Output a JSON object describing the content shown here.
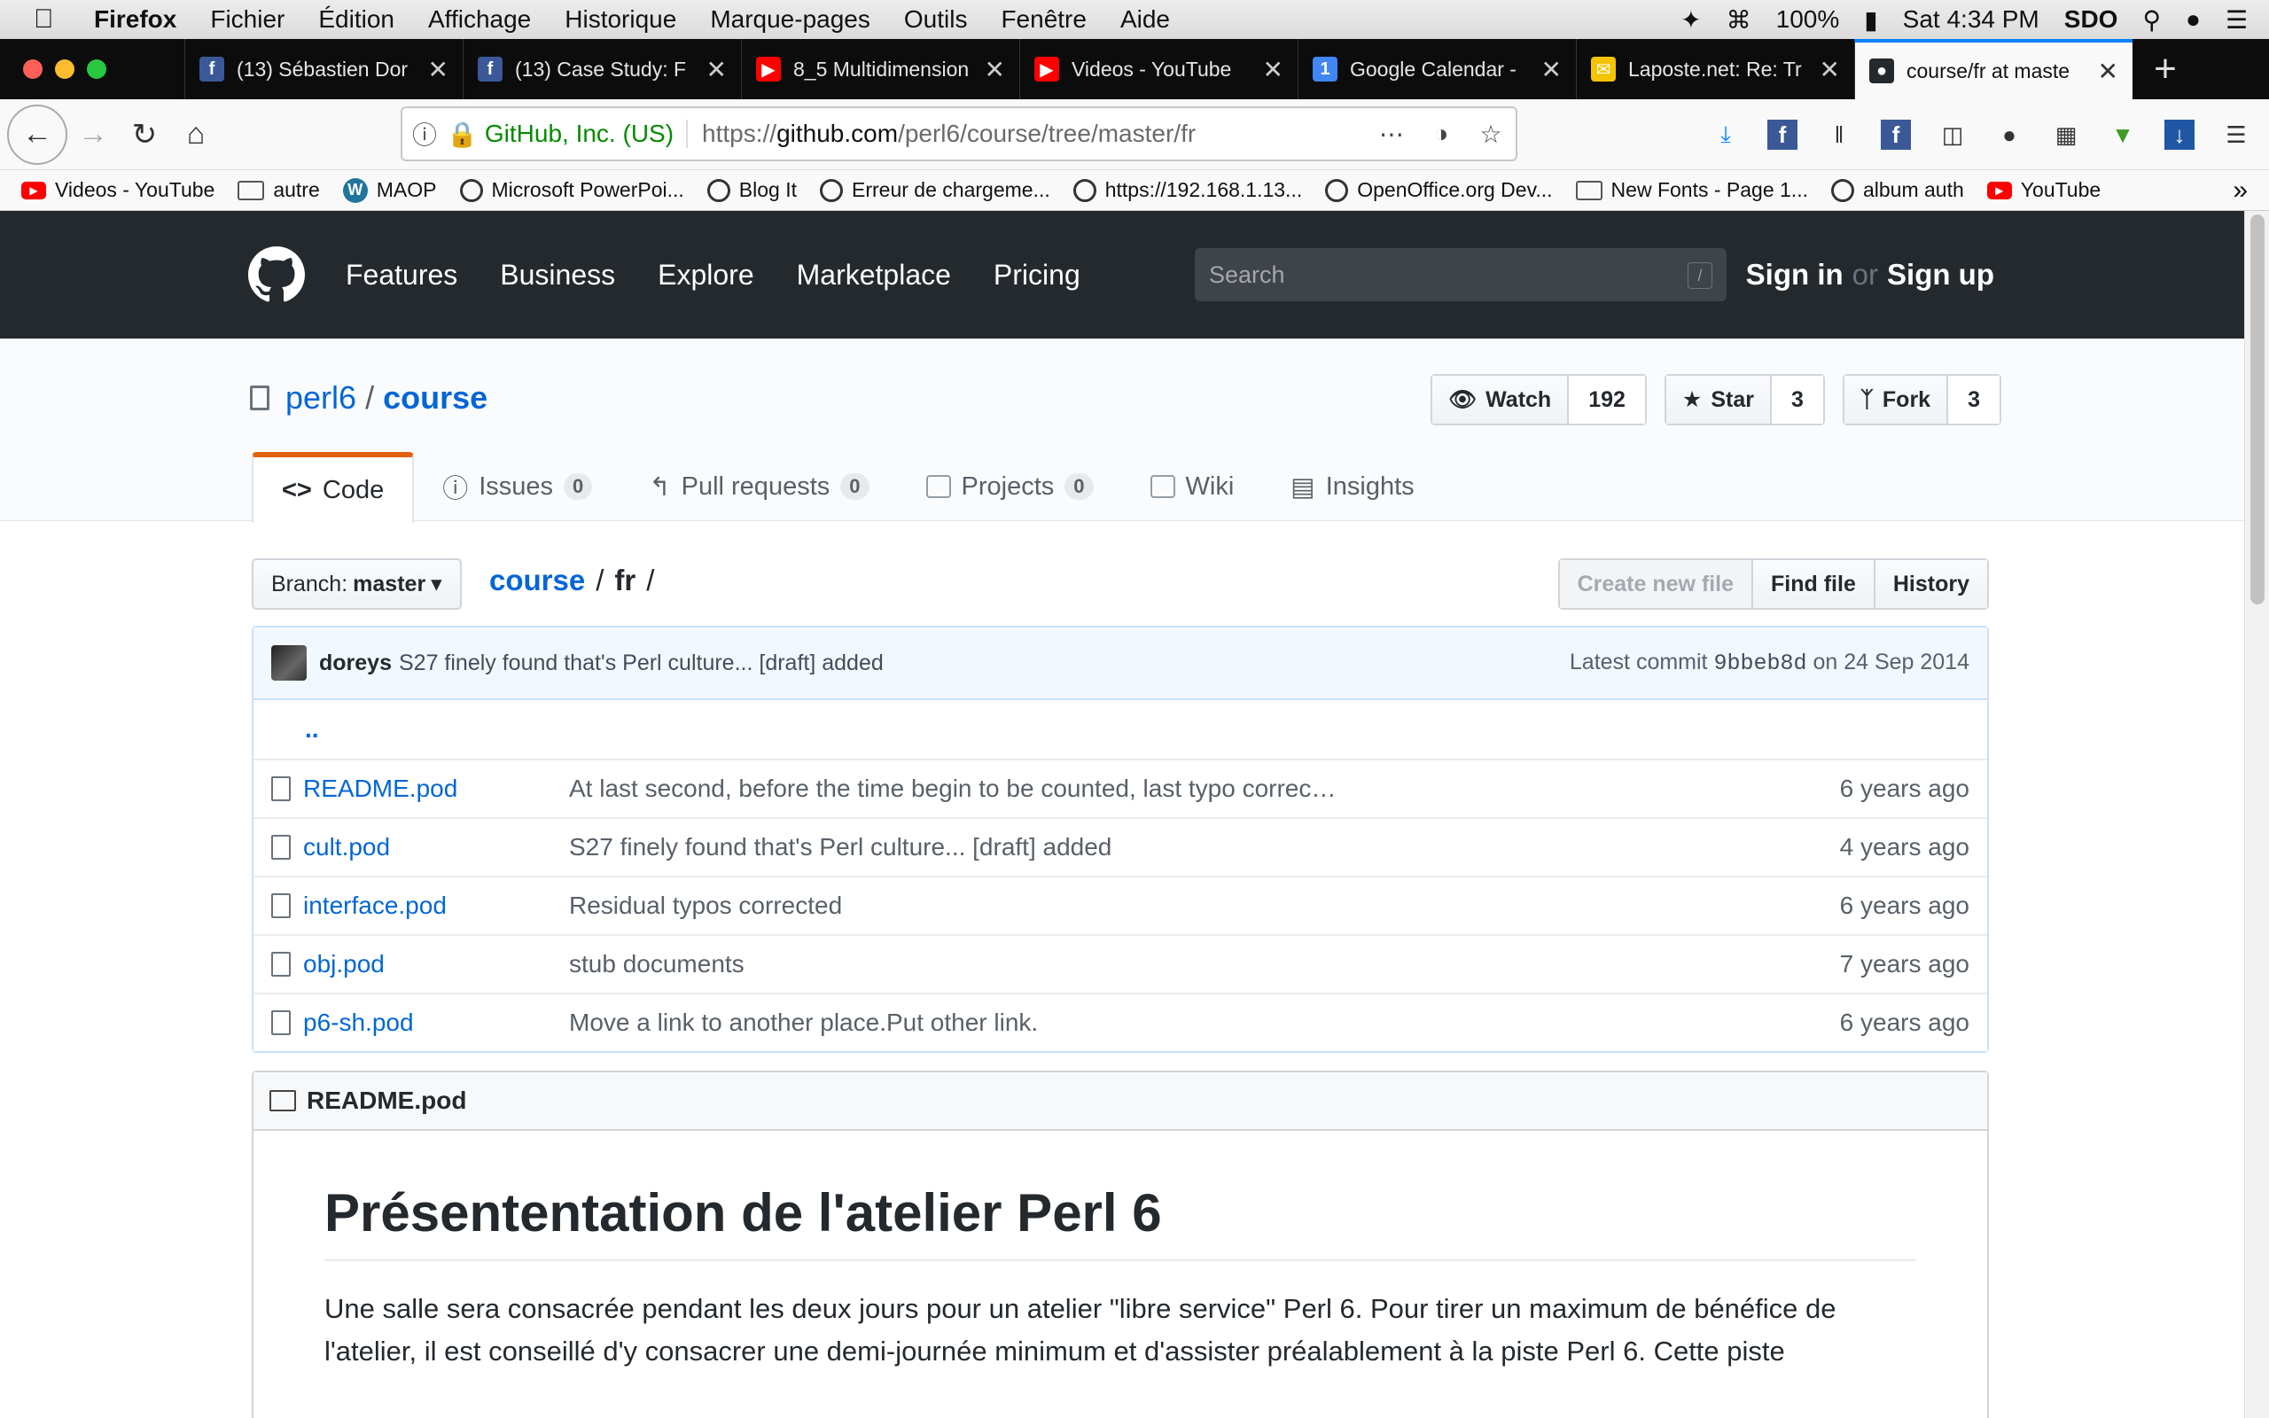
{
  "menubar": {
    "app": "Firefox",
    "items": [
      "Fichier",
      "Édition",
      "Affichage",
      "Historique",
      "Marque-pages",
      "Outils",
      "Fenêtre",
      "Aide"
    ],
    "battery": "100%",
    "clock": "Sat 4:34 PM",
    "user": "SDO"
  },
  "tabs": [
    {
      "title": "(13) Sébastien Dor",
      "icon": "facebook-icon",
      "color": "#3b5998",
      "glyph": "f"
    },
    {
      "title": "(13) Case Study: F",
      "icon": "facebook-icon",
      "color": "#3b5998",
      "glyph": "f"
    },
    {
      "title": "8_5 Multidimension",
      "icon": "youtube-icon",
      "color": "#ff0000",
      "glyph": "▶"
    },
    {
      "title": "Videos - YouTube",
      "icon": "youtube-icon",
      "color": "#ff0000",
      "glyph": "▶"
    },
    {
      "title": "Google Calendar -",
      "icon": "calendar-icon",
      "color": "#4285f4",
      "glyph": "1"
    },
    {
      "title": "Laposte.net: Re: Tr",
      "icon": "laposte-icon",
      "color": "#f4c400",
      "glyph": "✉"
    },
    {
      "title": "course/fr at maste",
      "icon": "github-icon",
      "color": "#24292e",
      "glyph": "●",
      "active": true
    }
  ],
  "urlbar": {
    "site": "GitHub, Inc. (US)",
    "url_prefix": "https://",
    "url_domain": "github.com",
    "url_path": "/perl6/course/tree/master/fr"
  },
  "bookmarks": [
    {
      "label": "Videos - YouTube",
      "icon": "youtube-icon"
    },
    {
      "label": "autre",
      "icon": "folder-icon"
    },
    {
      "label": "MAOP",
      "icon": "wordpress-icon"
    },
    {
      "label": "Microsoft PowerPoi...",
      "icon": "globe-icon"
    },
    {
      "label": "Blog It",
      "icon": "globe-icon"
    },
    {
      "label": "Erreur de chargeme...",
      "icon": "globe-icon"
    },
    {
      "label": "https://192.168.1.13...",
      "icon": "globe-icon"
    },
    {
      "label": "OpenOffice.org Dev...",
      "icon": "globe-icon"
    },
    {
      "label": "New Fonts - Page 1...",
      "icon": "fonts-icon"
    },
    {
      "label": "album auth",
      "icon": "globe-icon"
    },
    {
      "label": "YouTube",
      "icon": "youtube-icon"
    }
  ],
  "github": {
    "nav": [
      "Features",
      "Business",
      "Explore",
      "Marketplace",
      "Pricing"
    ],
    "search_placeholder": "Search",
    "search_key": "/",
    "sign_in": "Sign in",
    "or": "or",
    "sign_up": "Sign up"
  },
  "repo": {
    "owner": "perl6",
    "name": "course",
    "watch_label": "Watch",
    "watch_count": "192",
    "star_label": "Star",
    "star_count": "3",
    "fork_label": "Fork",
    "fork_count": "3",
    "tabs": [
      {
        "label": "Code",
        "counter": ""
      },
      {
        "label": "Issues",
        "counter": "0"
      },
      {
        "label": "Pull requests",
        "counter": "0"
      },
      {
        "label": "Projects",
        "counter": "0"
      },
      {
        "label": "Wiki",
        "counter": ""
      },
      {
        "label": "Insights",
        "counter": ""
      }
    ]
  },
  "filenav": {
    "branch_prefix": "Branch:",
    "branch": "master",
    "path_root": "course",
    "path_dir": "fr",
    "create": "Create new file",
    "find": "Find file",
    "history": "History"
  },
  "commit": {
    "author": "doreys",
    "message": "S27 finely found that's Perl culture... [draft] added",
    "latest_prefix": "Latest commit",
    "sha": "9bbeb8d",
    "date": "on 24 Sep 2014"
  },
  "files": [
    {
      "name": "README.pod",
      "message": "At last second, before the time begin to be counted, last typo correc…",
      "age": "6 years ago"
    },
    {
      "name": "cult.pod",
      "message": "S27 finely found that's Perl culture... [draft] added",
      "age": "4 years ago"
    },
    {
      "name": "interface.pod",
      "message": "Residual typos corrected",
      "age": "6 years ago"
    },
    {
      "name": "obj.pod",
      "message": "stub documents",
      "age": "7 years ago"
    },
    {
      "name": "p6-sh.pod",
      "message": "Move a link to another place.Put other link.",
      "age": "6 years ago"
    }
  ],
  "up_dir": "..",
  "readme": {
    "filename": "README.pod",
    "heading": "Présententation de l'atelier Perl 6",
    "paragraph": "Une salle sera consacrée pendant les deux jours pour un atelier \"libre service\" Perl 6. Pour tirer un maximum de bénéfice de l'atelier, il est conseillé d'y consacrer une demi-journée minimum et d'assister préalablement à la piste Perl 6. Cette piste"
  }
}
